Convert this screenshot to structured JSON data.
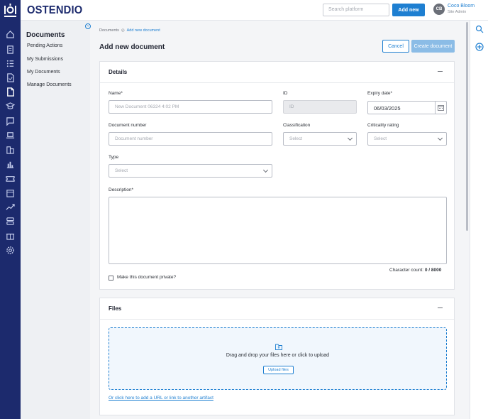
{
  "app": {
    "brand": "OSTENDIO",
    "search_placeholder": "Search platform",
    "add_new_label": "Add new",
    "user": {
      "initials": "CB",
      "name": "Coco Bloom",
      "role": "Site Admin"
    }
  },
  "sidebar_icons": [
    "home-icon",
    "clipboard-icon",
    "checklist-icon",
    "file-check-icon",
    "document-icon",
    "graduation-cap-icon",
    "chat-icon",
    "laptop-icon",
    "building-icon",
    "bar-chart-icon",
    "ticket-icon",
    "calendar-icon",
    "trending-up-icon",
    "server-icon",
    "gift-icon",
    "settings-icon"
  ],
  "subnav": {
    "title": "Documents",
    "items": [
      "Pending Actions",
      "My Submissions",
      "My Documents",
      "Manage Documents"
    ]
  },
  "breadcrumb": {
    "root": "Documents",
    "current": "Add new document"
  },
  "page": {
    "title": "Add new document",
    "cancel_label": "Cancel",
    "create_label": "Create document"
  },
  "details": {
    "title": "Details",
    "name_label": "Name*",
    "name_placeholder": "New Document 06324 4:02 PM",
    "id_label": "ID",
    "id_placeholder": "ID",
    "expiry_label": "Expiry date*",
    "expiry_value": "06/03/2025",
    "doc_number_label": "Document number",
    "doc_number_placeholder": "Document number",
    "classification_label": "Classification",
    "classification_value": "Select",
    "criticality_label": "Criticality rating",
    "criticality_value": "Select",
    "type_label": "Type",
    "type_value": "Select",
    "description_label": "Description*",
    "char_count_label": "Character count:",
    "char_count_value": "0 / 8000",
    "private_label": "Make this document private?"
  },
  "files": {
    "title": "Files",
    "drop_text": "Drag and drop your files here or click to upload",
    "upload_label": "Upload files",
    "url_link": "Or click here to add a URL or link to another artifact"
  },
  "colors": {
    "nav": "#1c2a6d",
    "accent": "#1e7fd1",
    "create_disabled": "#8bbce6"
  }
}
